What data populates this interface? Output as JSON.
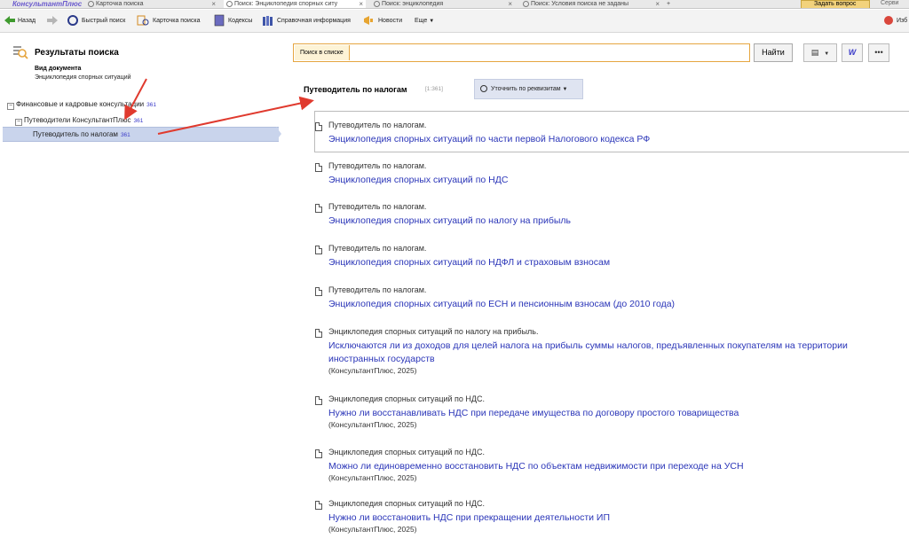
{
  "tabs": {
    "brand": "КонсультантПлюс",
    "items": [
      {
        "label": "Карточка поиска"
      },
      {
        "label": "Поиск: Энциклопедия спорных ситу"
      },
      {
        "label": "Поиск: энциклопедия"
      },
      {
        "label": "Поиск: Условия поиска не заданы"
      }
    ],
    "ask_question": "Задать вопрос",
    "service": "Серви"
  },
  "toolbar": {
    "back": "Назад",
    "quick_search": "Быстрый поиск",
    "search_card": "Карточка поиска",
    "codes": "Кодексы",
    "reference": "Справочная информация",
    "news": "Новости",
    "more": "Еще",
    "favorites": "Изб"
  },
  "left": {
    "title": "Результаты поиска",
    "doc_kind_label": "Вид документа",
    "doc_kind_value": "Энциклопедия спорных ситуаций",
    "tree": [
      {
        "label": "Финансовые и кадровые консультации",
        "count": "361"
      },
      {
        "label": "Путеводители КонсультантПлюс",
        "count": "361"
      },
      {
        "label": "Путеводитель по налогам",
        "count": "361"
      }
    ]
  },
  "search": {
    "label": "Поиск в списке",
    "value": "",
    "find_button": "Найти"
  },
  "results": {
    "header_title": "Путеводитель по налогам",
    "header_count": "[1:361]",
    "refine_button": "Уточнить по реквизитам",
    "items": [
      {
        "source": "Путеводитель по налогам.",
        "title": "Энциклопедия спорных ситуаций по части первой Налогового кодекса РФ",
        "pub": ""
      },
      {
        "source": "Путеводитель по налогам.",
        "title": "Энциклопедия спорных ситуаций по НДС",
        "pub": ""
      },
      {
        "source": "Путеводитель по налогам.",
        "title": "Энциклопедия спорных ситуаций по налогу на прибыль",
        "pub": ""
      },
      {
        "source": "Путеводитель по налогам.",
        "title": "Энциклопедия спорных ситуаций по НДФЛ и страховым взносам",
        "pub": ""
      },
      {
        "source": "Путеводитель по налогам.",
        "title": "Энциклопедия спорных ситуаций по ЕСН и пенсионным взносам (до 2010 года)",
        "pub": ""
      },
      {
        "source": "Энциклопедия спорных ситуаций по налогу на прибыль.",
        "title": "Исключаются ли из доходов для целей налога на прибыль суммы налогов, предъявленных покупателям на территории иностранных государств",
        "pub": "(КонсультантПлюс, 2025)"
      },
      {
        "source": "Энциклопедия спорных ситуаций по НДС.",
        "title": "Нужно ли восстанавливать НДС при передаче имущества по договору простого товарищества",
        "pub": "(КонсультантПлюс, 2025)"
      },
      {
        "source": "Энциклопедия спорных ситуаций по НДС.",
        "title": "Можно ли единовременно восстановить НДС по объектам недвижимости при переходе на УСН",
        "pub": "(КонсультантПлюс, 2025)"
      },
      {
        "source": "Энциклопедия спорных ситуаций по НДС.",
        "title": "Нужно ли восстановить НДС при прекращении деятельности ИП",
        "pub": "(КонсультантПлюс, 2025)"
      }
    ]
  },
  "colors": {
    "link": "#2a35b8",
    "arrow": "#e03a2e",
    "accent": "#e6a640",
    "selection": "#c9d4ec"
  }
}
